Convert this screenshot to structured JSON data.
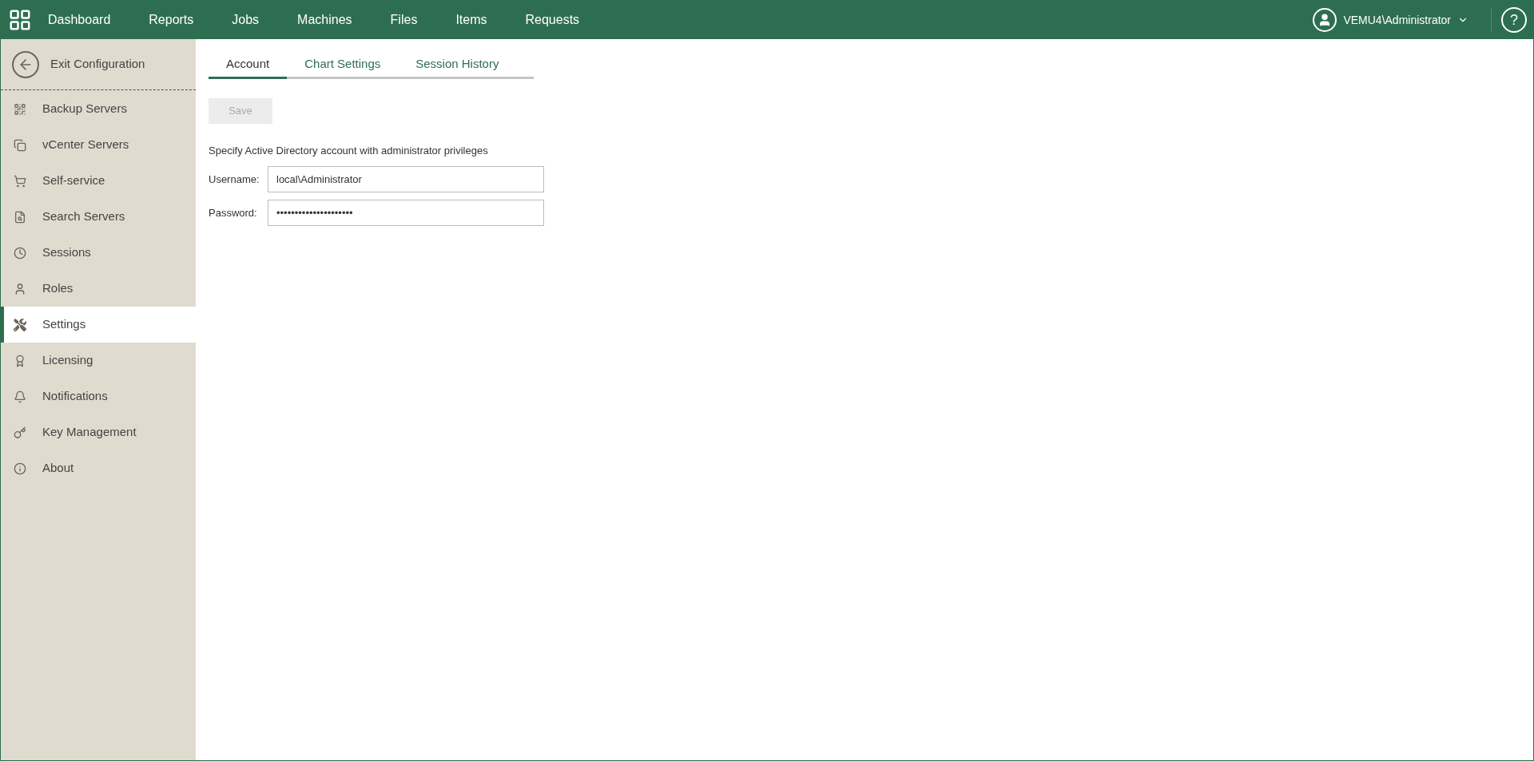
{
  "nav": {
    "items": [
      {
        "label": "Dashboard",
        "selected": false
      },
      {
        "label": "Reports",
        "selected": false
      },
      {
        "label": "Jobs",
        "selected": false
      },
      {
        "label": "Machines",
        "selected": false
      },
      {
        "label": "Files",
        "selected": false
      },
      {
        "label": "Items",
        "selected": false
      },
      {
        "label": "Requests",
        "selected": false
      }
    ],
    "user": "VEMU4\\Administrator",
    "help": "?"
  },
  "sidebar": {
    "exit": "Exit Configuration",
    "items": [
      {
        "label": "Backup Servers",
        "selected": false
      },
      {
        "label": "vCenter Servers",
        "selected": false
      },
      {
        "label": "Self-service",
        "selected": false
      },
      {
        "label": "Search Servers",
        "selected": false
      },
      {
        "label": "Sessions",
        "selected": false
      },
      {
        "label": "Roles",
        "selected": false
      },
      {
        "label": "Settings",
        "selected": true
      },
      {
        "label": "Licensing",
        "selected": false
      },
      {
        "label": "Notifications",
        "selected": false
      },
      {
        "label": "Key Management",
        "selected": false
      },
      {
        "label": "About",
        "selected": false
      }
    ]
  },
  "tabs": [
    {
      "label": "Account",
      "selected": true
    },
    {
      "label": "Chart Settings",
      "selected": false
    },
    {
      "label": "Session History",
      "selected": false
    }
  ],
  "save_button": {
    "label": "Save",
    "disabled": true
  },
  "description": "Specify Active Directory account with administrator privileges",
  "fields": [
    {
      "label": "Username:",
      "value": "local\\Administrator"
    },
    {
      "label": "Password:",
      "value": "•••••••••••••••••••••"
    }
  ]
}
